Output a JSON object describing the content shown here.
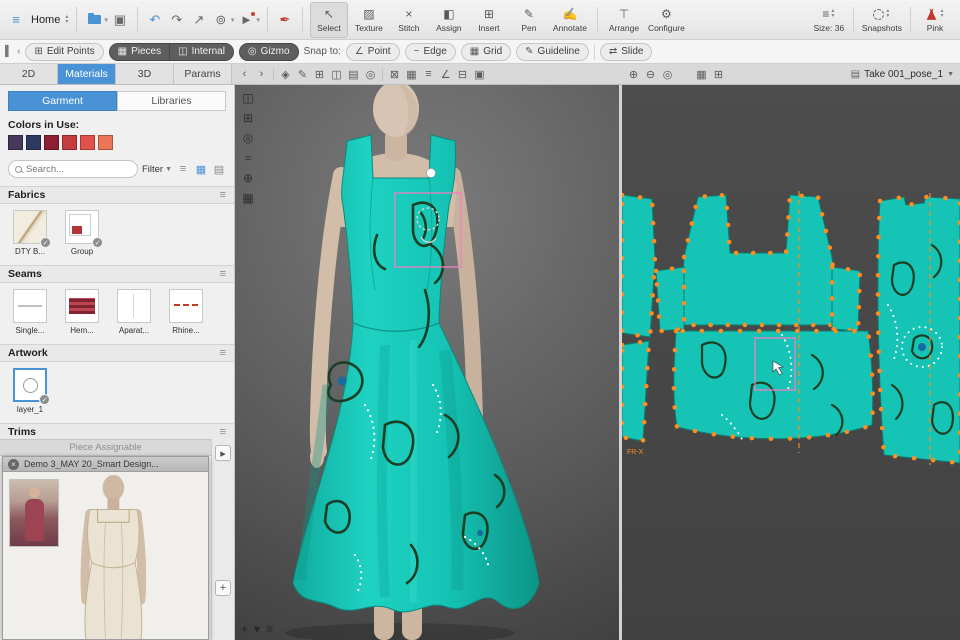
{
  "colors": {
    "accent-blue": "#4a92d6",
    "teal": "#15c4b4",
    "teal-line": "#0c7c72",
    "artwork-green": "#1b3f24",
    "selection-pink": "#f07fc2",
    "point-orange": "#ff8d1f",
    "skin": "#d8c4b2"
  },
  "top_toolbar": {
    "home_label": "Home",
    "tools": [
      {
        "label": "Select"
      },
      {
        "label": "Texture"
      },
      {
        "label": "Stitch"
      },
      {
        "label": "Assign"
      },
      {
        "label": "Insert"
      },
      {
        "label": "Pen"
      },
      {
        "label": "Annotate"
      },
      {
        "label": "Arrange"
      },
      {
        "label": "Configure"
      }
    ],
    "size_label": "Size: 36",
    "snapshots_label": "Snapshots",
    "colorway_label": "Pink"
  },
  "edit_toolbar": {
    "edit_points_label": "Edit Points",
    "pieces_label": "Pieces",
    "internal_label": "Internal",
    "gizmo_label": "Gizmo",
    "snap_to_label": "Snap to:",
    "snap_options": [
      {
        "label": "Point"
      },
      {
        "label": "Edge"
      },
      {
        "label": "Grid"
      },
      {
        "label": "Guideline"
      }
    ],
    "slide_label": "Slide"
  },
  "tab_bar": {
    "tabs": [
      {
        "label": "2D"
      },
      {
        "label": "Materials"
      },
      {
        "label": "3D"
      },
      {
        "label": "Params"
      }
    ],
    "pose_label": "Take 001_pose_1"
  },
  "sidebar": {
    "tabs": [
      {
        "label": "Garment"
      },
      {
        "label": "Libraries"
      }
    ],
    "colors_in_use_label": "Colors in Use:",
    "swatches": [
      "#45385a",
      "#2c3a62",
      "#8c1f33",
      "#c43b40",
      "#e1514a",
      "#ec7556"
    ],
    "search_placeholder": "Search...",
    "filter_label": "Filter",
    "sections": {
      "fabrics": {
        "title": "Fabrics",
        "items": [
          {
            "label": "DTY B..."
          },
          {
            "label": "Group"
          }
        ]
      },
      "seams": {
        "title": "Seams",
        "items": [
          {
            "label": "Single..."
          },
          {
            "label": "Hem..."
          },
          {
            "label": "Aparat..."
          },
          {
            "label": "Rhine..."
          }
        ]
      },
      "artwork": {
        "title": "Artwork",
        "items": [
          {
            "label": "layer_1"
          }
        ]
      },
      "trims": {
        "title": "Trims"
      }
    },
    "piece_assignable_label": "Piece Assignable",
    "avatar_window": {
      "title": "Demo 3_MAY 20_Smart Design..."
    }
  },
  "viewport_2d": {
    "piece_label": "FR-X"
  }
}
